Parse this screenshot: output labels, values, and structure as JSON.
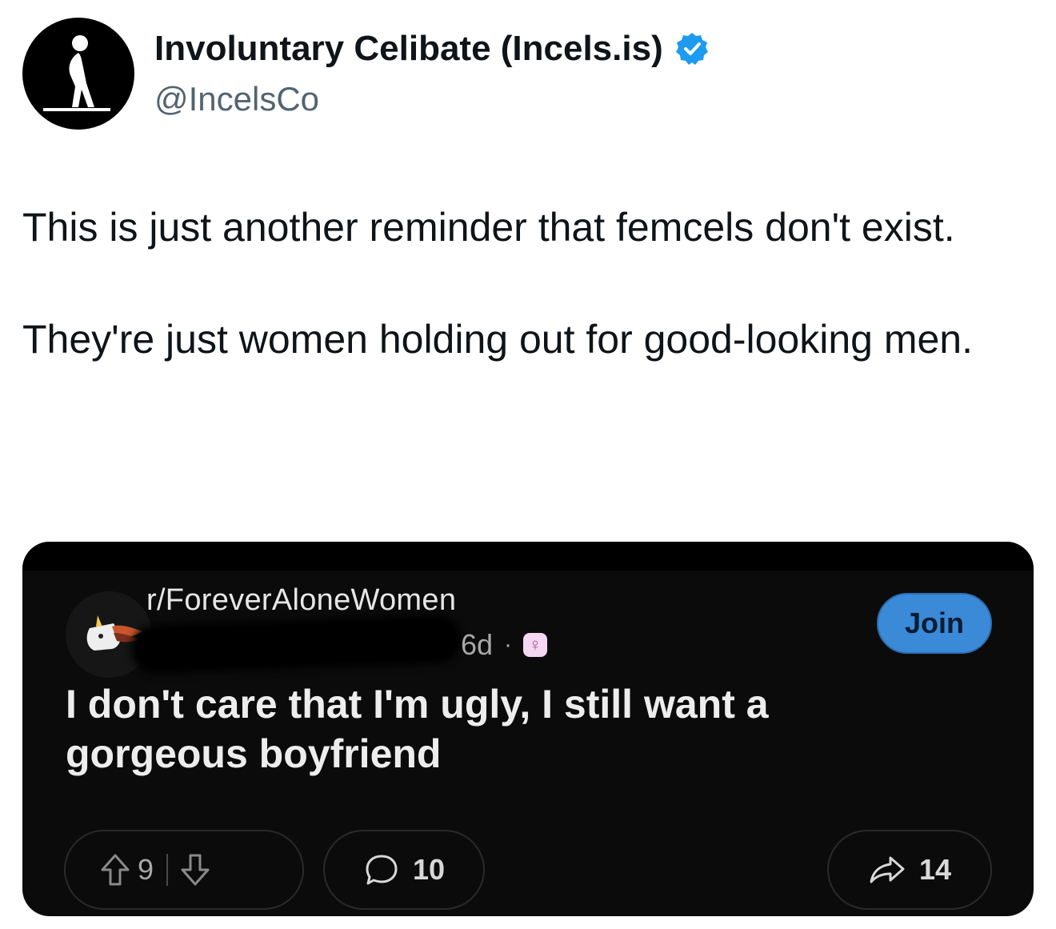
{
  "tweet": {
    "author_name": "Involuntary Celibate (Incels.is)",
    "handle": "@IncelsCo",
    "verified_icon": "verified-badge-icon",
    "verified_color": "#1d9bf0",
    "text_paragraphs": [
      "This is just another reminder that femcels don't exist.",
      "They're just women holding out for good-looking men."
    ]
  },
  "embedded_post": {
    "subreddit": "r/ForeverAloneWomen",
    "age": "6d",
    "separator": "·",
    "flair_icon": "female-symbol-icon",
    "join_label": "Join",
    "join_color": "#3a8ad8",
    "title": "I don't care that I'm ugly, I still want a gorgeous boyfriend",
    "upvotes": "9",
    "comments": "10",
    "shares": "14"
  }
}
